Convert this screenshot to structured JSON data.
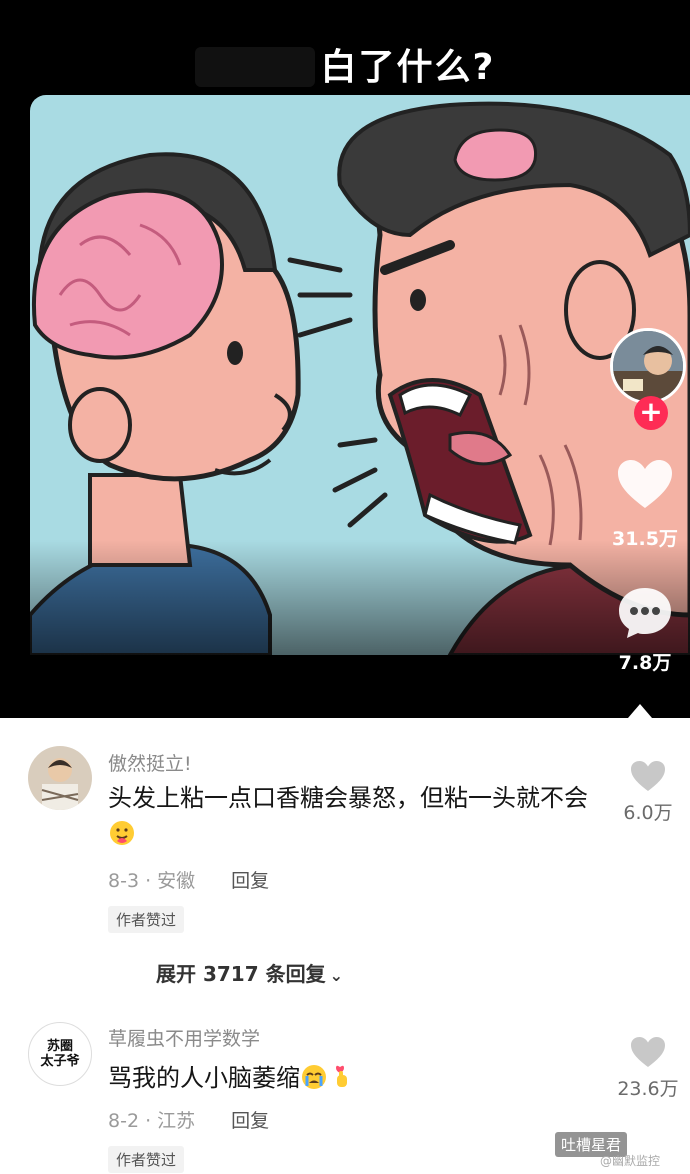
{
  "video": {
    "title": "白了什么?",
    "likes": "31.5万",
    "comments": "7.8万",
    "follow_symbol": "+"
  },
  "comments": [
    {
      "username": "傲然挺立!",
      "text": "头发上粘一点口香糖会暴怒，但粘一头就不会",
      "date_location": "8-3 · 安徽",
      "reply_label": "回复",
      "badge": "作者赞过",
      "likes": "6.0万"
    },
    {
      "username": "草履虫不用学数学",
      "avatar_text_line1": "苏圈",
      "avatar_text_line2": "太子爷",
      "text": "骂我的人小脑萎缩",
      "date_location": "8-2 · 江苏",
      "reply_label": "回复",
      "badge": "作者赞过",
      "likes": "23.6万"
    }
  ],
  "expand_replies": "展开 3717 条回复",
  "watermark": "吐槽星君",
  "watermark_sub": "@幽默监控",
  "icons": {
    "follow": "plus-icon",
    "like": "heart-icon",
    "comment": "comment-bubble-icon",
    "expand": "chevron-down-icon"
  },
  "colors": {
    "accent": "#fe2c55",
    "sky": "#a9dbe3",
    "brain": "#f29ab2"
  }
}
